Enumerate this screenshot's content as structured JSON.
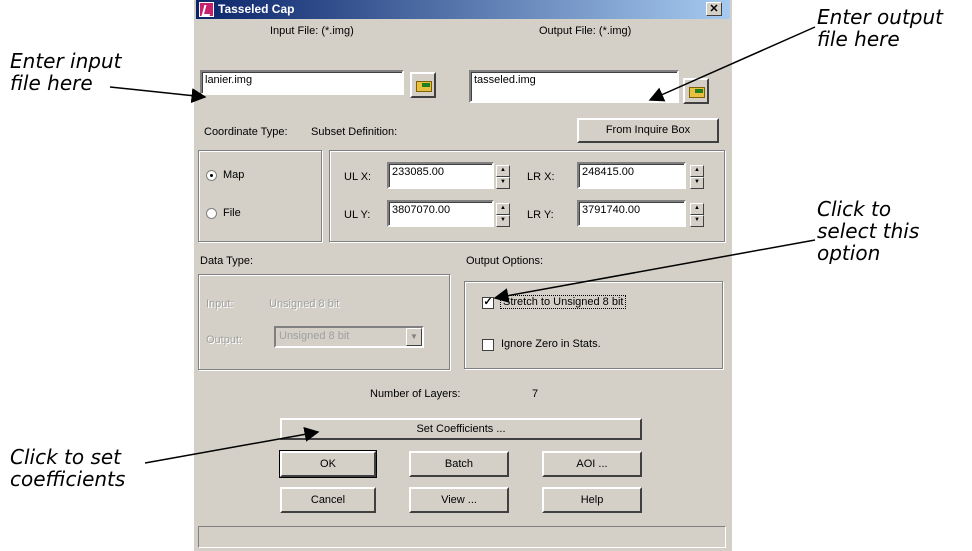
{
  "callouts": {
    "input": "Enter input\nfile here",
    "output": "Enter output\nfile here",
    "option": "Click to\nselect this\noption",
    "coeff": "Click to set\ncoefficients"
  },
  "dialog": {
    "title": "Tasseled Cap",
    "close_glyph": "✕",
    "input_file_label": "Input File: (*.img)",
    "output_file_label": "Output File: (*.img)",
    "input_file_value": "lanier.img",
    "output_file_value": "tasseled.img",
    "coordinate_type_label": "Coordinate Type:",
    "subset_definition_label": "Subset Definition:",
    "from_inquire_box": "From Inquire Box",
    "radio_map": "Map",
    "radio_file": "File",
    "selected_coordinate": "Map",
    "ulx_label": "UL X:",
    "uly_label": "UL Y:",
    "lrx_label": "LR X:",
    "lry_label": "LR Y:",
    "ulx": "233085.00",
    "uly": "3807070.00",
    "lrx": "248415.00",
    "lry": "3791740.00",
    "data_type_label": "Data Type:",
    "input_label": "Input:",
    "input_type": "Unsigned 8 bit",
    "output_label": "Output:",
    "output_type": "Unsigned 8 bit",
    "output_options_label": "Output Options:",
    "stretch_label": "Stretch to Unsigned 8 bit",
    "stretch_checked": true,
    "ignore_zero_label": "Ignore Zero in Stats.",
    "ignore_zero_checked": false,
    "num_layers_label": "Number of Layers:",
    "num_layers": "7",
    "set_coefficients": "Set Coefficients ...",
    "ok": "OK",
    "batch": "Batch",
    "aoi": "AOI ...",
    "cancel": "Cancel",
    "view": "View ...",
    "help": "Help"
  }
}
